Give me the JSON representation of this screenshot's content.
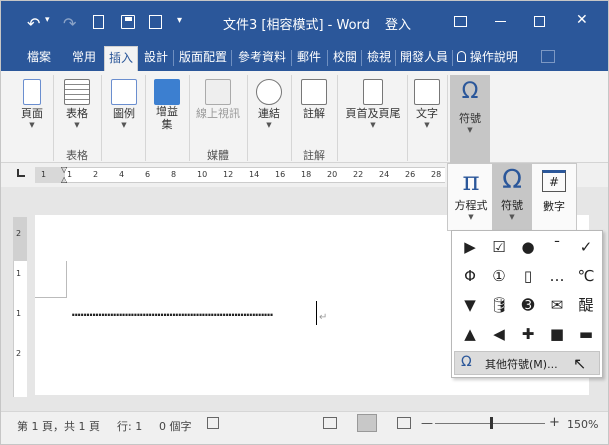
{
  "title": {
    "document": "文件3 [相容模式] - Word",
    "signin": "登入"
  },
  "qat": {
    "undo": "↶",
    "redo": "↷",
    "new": "🗋",
    "save": "💾",
    "more": "▾"
  },
  "window": {
    "restore": "▭",
    "minimize": "—",
    "maximize": "☐",
    "close": "✕"
  },
  "tabs": [
    "檔案",
    "常用",
    "插入",
    "設計",
    "版面配置",
    "參考資料",
    "郵件",
    "校閱",
    "檢視",
    "開發人員",
    "操作說明"
  ],
  "tell_me": {
    "icon": "lightbulb-icon",
    "label": "操作說明"
  },
  "ribbon": {
    "pages": "頁面",
    "table": "表格",
    "illustrations": "圖例",
    "addins": "增益集",
    "online_video": "線上視訊",
    "links": "連結",
    "comment": "註解",
    "header_footer": "頁首及頁尾",
    "text": "文字",
    "symbols": "符號",
    "groups": {
      "table": "表格",
      "media": "媒體",
      "comments": "註解"
    }
  },
  "gallery": {
    "equation": "方程式",
    "symbol": "符號",
    "number": "數字",
    "pi": "π",
    "omega": "Ω",
    "hash": "#"
  },
  "symbols": [
    "▶",
    "☑",
    "●",
    "¯",
    "✓",
    "Φ",
    "①",
    "▯",
    "…",
    "℃",
    "▼",
    "🛢",
    "➌",
    "✉",
    "醍",
    "▲",
    "◀",
    "✚",
    "■",
    "▬"
  ],
  "more_symbols": "其他符號(M)...",
  "more_symbols_icon": "Ω",
  "document": {
    "paragraph_mark": "↵",
    "tab_leader": "...................................................................."
  },
  "ruler": {
    "marks_h": [
      "1",
      "1",
      "2",
      "4",
      "6",
      "8",
      "10",
      "12",
      "14",
      "16",
      "18",
      "20",
      "22",
      "24",
      "26",
      "28"
    ],
    "marks_v": [
      "2",
      "1",
      "1",
      "2"
    ]
  },
  "status": {
    "page": "第 1 頁，共 1 頁",
    "line": "行: 1",
    "words": "0 個字",
    "zoom": "150%",
    "zoom_fraction": 0.5
  },
  "colors": {
    "brand": "#2b579a",
    "ribbon": "#f3f3f3"
  }
}
